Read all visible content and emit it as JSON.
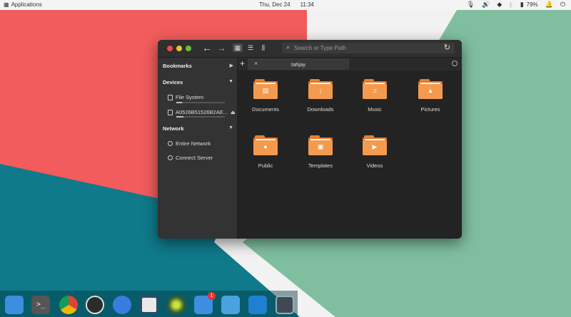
{
  "panel": {
    "applications_label": "Applications",
    "date": "Thu, Dec 24",
    "time": "11:34",
    "battery_percent": "79%"
  },
  "window": {
    "search_placeholder": "Search or Type Path",
    "tab_label": "tahjay"
  },
  "sidebar": {
    "bookmarks_label": "Bookmarks",
    "devices_label": "Devices",
    "network_label": "Network",
    "devices": [
      {
        "label": "File System",
        "usage": 0.12
      },
      {
        "label": "A0526B51526B2AE...",
        "usage": 0.15
      }
    ],
    "network_items": [
      {
        "label": "Entire Network"
      },
      {
        "label": "Connect Server"
      }
    ]
  },
  "folders": [
    {
      "label": "Documents",
      "icon": "document-icon"
    },
    {
      "label": "Downloads",
      "icon": "download-icon"
    },
    {
      "label": "Music",
      "icon": "music-icon"
    },
    {
      "label": "Pictures",
      "icon": "picture-icon"
    },
    {
      "label": "Public",
      "icon": "user-icon"
    },
    {
      "label": "Templates",
      "icon": "template-icon"
    },
    {
      "label": "Videos",
      "icon": "play-icon"
    }
  ],
  "dock": {
    "apps": [
      "files",
      "terminal",
      "chrome",
      "obs",
      "settings-toggle",
      "multitasking",
      "green-orb",
      "mail",
      "tasks",
      "vscode",
      "screen"
    ],
    "mail_badge": "1"
  },
  "colors": {
    "wallpaper_teal": "#0f7a8a",
    "wallpaper_red": "#f25c5c",
    "wallpaper_green": "#7fbf9f",
    "wallpaper_white": "#f2f2f2",
    "folder_orange": "#f39a4e"
  }
}
